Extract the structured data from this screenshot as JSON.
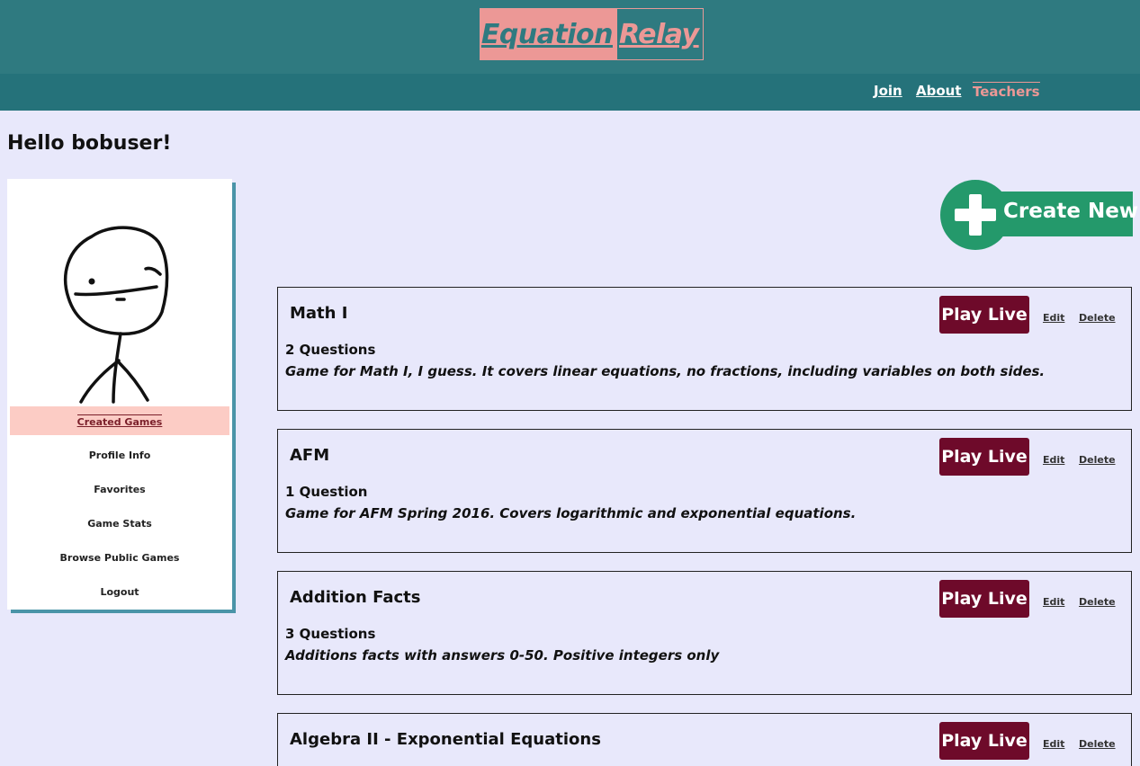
{
  "header": {
    "logo_word1": "Equation",
    "logo_word2": "Relay",
    "nav": [
      {
        "label": "Join"
      },
      {
        "label": "About"
      },
      {
        "label": "Teachers"
      }
    ]
  },
  "greeting": "Hello bobuser!",
  "sidebar": {
    "items": [
      {
        "label": "Created Games",
        "active": true
      },
      {
        "label": "Profile Info"
      },
      {
        "label": "Favorites"
      },
      {
        "label": "Game Stats"
      },
      {
        "label": "Browse Public Games"
      },
      {
        "label": "Logout"
      }
    ]
  },
  "create_button": {
    "label": "Create New"
  },
  "games": [
    {
      "title": "Math I",
      "count": "2 Questions",
      "description": "Game for Math I, I guess. It covers linear equations, no fractions, including variables on both sides.",
      "play": "Play Live",
      "edit": "Edit",
      "delete": "Delete"
    },
    {
      "title": "AFM",
      "count": "1 Question",
      "description": "Game for AFM Spring 2016. Covers logarithmic and exponential equations.",
      "play": "Play Live",
      "edit": "Edit",
      "delete": "Delete"
    },
    {
      "title": "Addition Facts",
      "count": "3 Questions",
      "description": "Additions facts with answers 0-50. Positive integers only",
      "play": "Play Live",
      "edit": "Edit",
      "delete": "Delete"
    },
    {
      "title": "Algebra II - Exponential Equations",
      "count": "",
      "description": "",
      "play": "Play Live",
      "edit": "Edit",
      "delete": "Delete"
    }
  ],
  "colors": {
    "header": "#2f7a80",
    "nav": "#25727a",
    "accent_pink": "#ec9896",
    "background": "#e8e8fb",
    "play_button": "#6e0a2a",
    "create_button": "#24996b"
  }
}
